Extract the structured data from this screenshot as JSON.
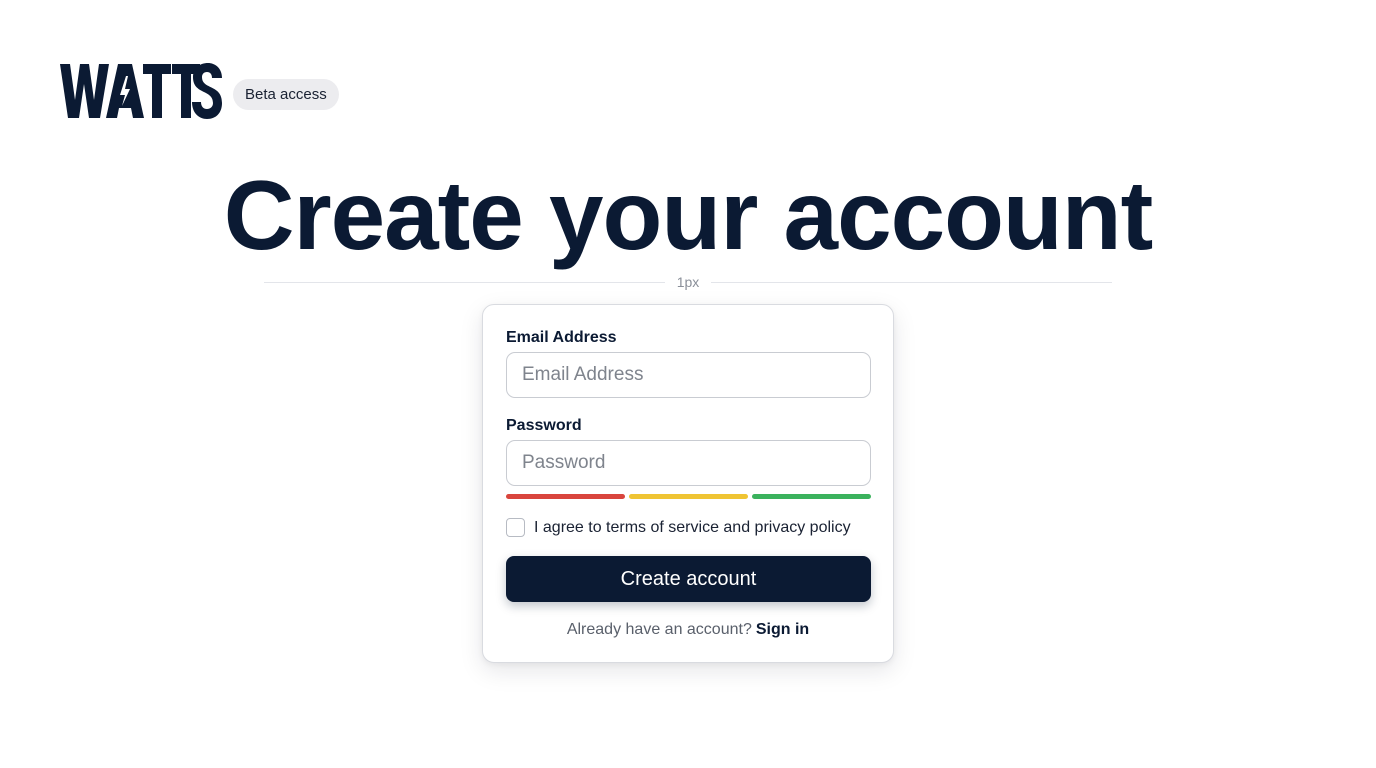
{
  "brand": {
    "name": "WATTS",
    "badge": "Beta access"
  },
  "page_title": "Create your account",
  "divider_label": "1px",
  "form": {
    "email": {
      "label": "Email Address",
      "placeholder": "Email Address",
      "value": ""
    },
    "password": {
      "label": "Password",
      "placeholder": "Password",
      "value": ""
    },
    "strength_colors": [
      "#d9453d",
      "#efc433",
      "#3bb25d"
    ],
    "agree_text": "I agree to terms of service and privacy policy",
    "agree_checked": false,
    "submit_label": "Create account",
    "signin_prompt": "Already have an account?",
    "signin_link": "Sign in"
  },
  "colors": {
    "brand_navy": "#0b1a33",
    "badge_bg": "#ececef"
  }
}
